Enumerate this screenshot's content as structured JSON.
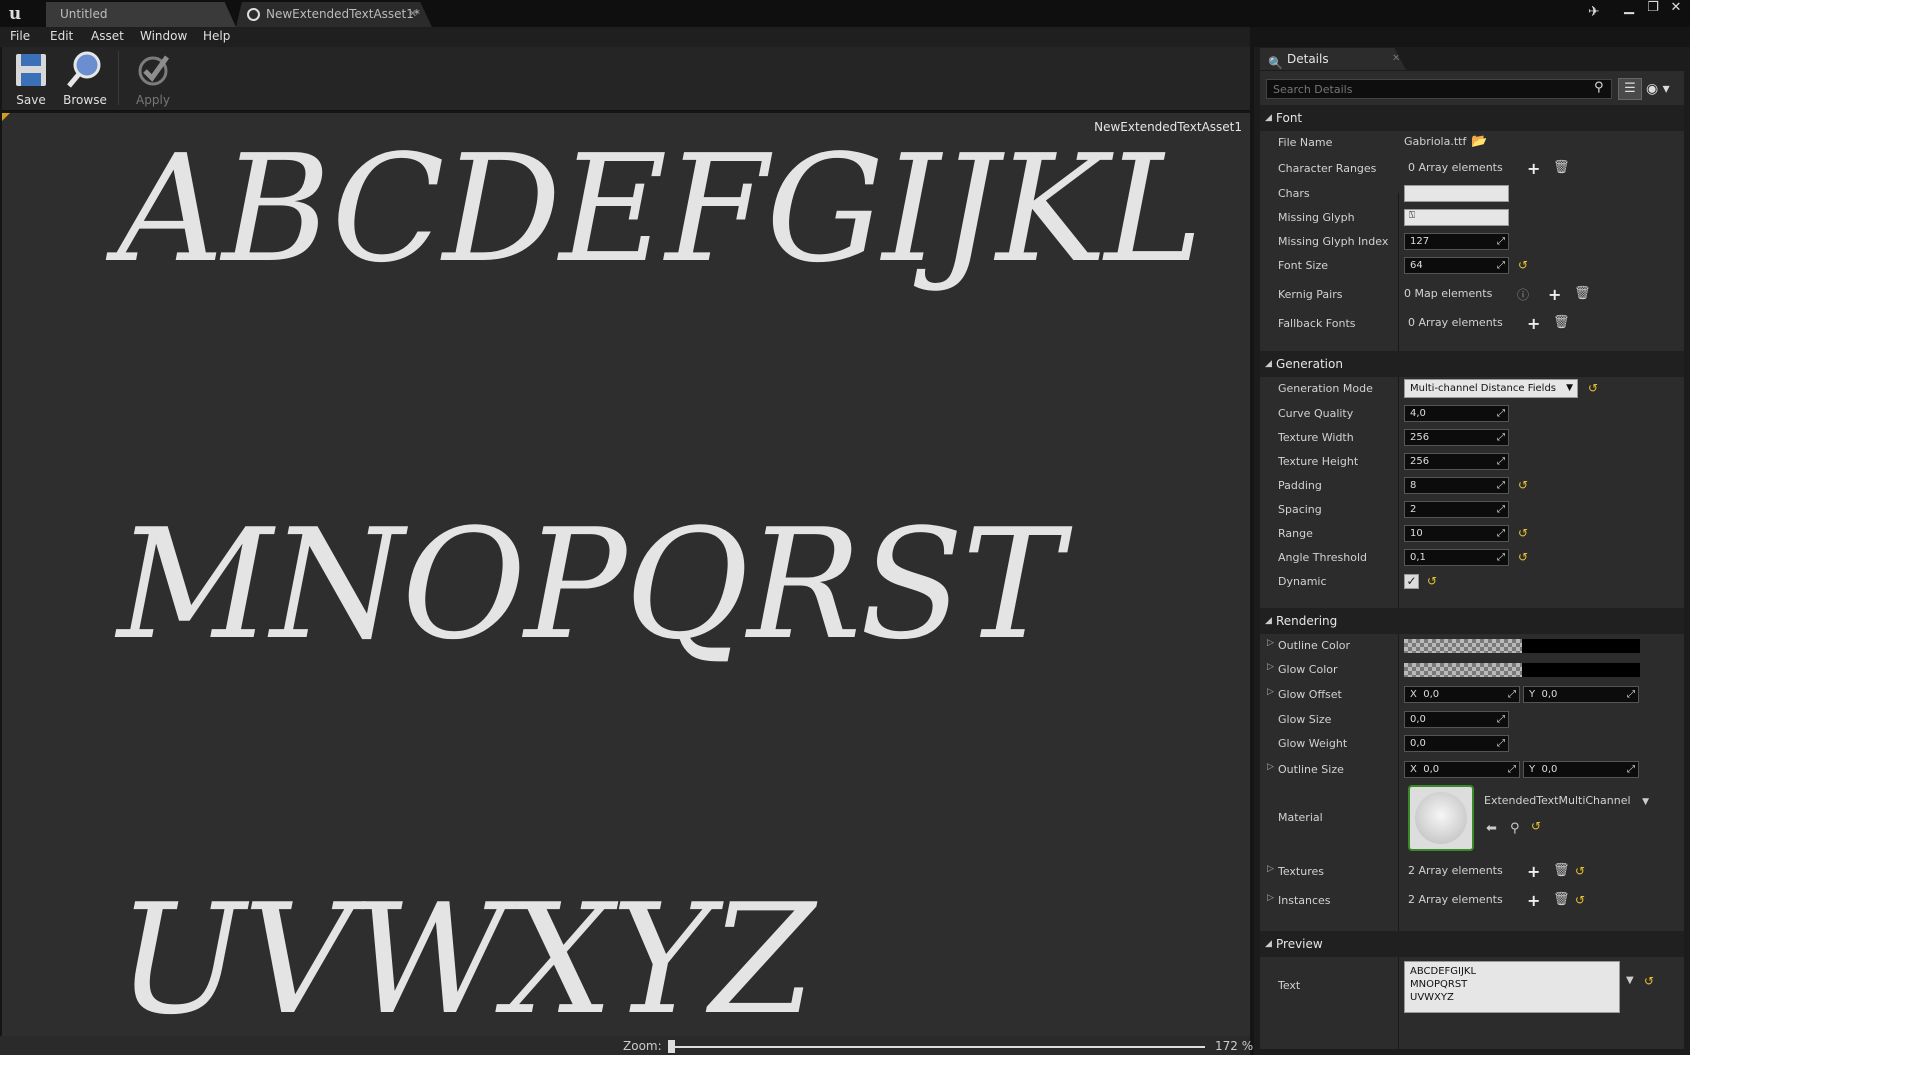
{
  "window": {
    "tabs": [
      {
        "label": "Untitled"
      },
      {
        "label": "NewExtendedTextAsset1*"
      }
    ]
  },
  "menu": [
    "File",
    "Edit",
    "Asset",
    "Window",
    "Help"
  ],
  "toolbar": {
    "save_label": "Save",
    "browse_label": "Browse",
    "apply_label": "Apply"
  },
  "viewport": {
    "asset_name": "NewExtendedTextAsset1",
    "preview_lines": [
      "ABCDEFGIJKL",
      "MNOPQRST",
      "UVWXYZ"
    ]
  },
  "zoom": {
    "label": "Zoom:",
    "value": "172 %",
    "level_fraction": 0.0
  },
  "details": {
    "tab_label": "Details",
    "search_placeholder": "Search Details",
    "sections": {
      "font": {
        "title": "Font",
        "file_name": {
          "label": "File Name",
          "value": "Gabriola.ttf"
        },
        "character_ranges": {
          "label": "Character Ranges",
          "value": "0 Array elements"
        },
        "chars": {
          "label": "Chars"
        },
        "missing_glyph": {
          "label": "Missing Glyph"
        },
        "missing_glyph_index": {
          "label": "Missing Glyph Index",
          "value": "127"
        },
        "font_size": {
          "label": "Font Size",
          "value": "64"
        },
        "kernig_pairs": {
          "label": "Kernig Pairs",
          "value": "0 Map elements"
        },
        "fallback_fonts": {
          "label": "Fallback Fonts",
          "value": "0 Array elements"
        }
      },
      "generation": {
        "title": "Generation",
        "generation_mode": {
          "label": "Generation Mode",
          "value": "Multi-channel Distance Fields"
        },
        "curve_quality": {
          "label": "Curve Quality",
          "value": "4,0"
        },
        "texture_width": {
          "label": "Texture Width",
          "value": "256"
        },
        "texture_height": {
          "label": "Texture Height",
          "value": "256"
        },
        "padding": {
          "label": "Padding",
          "value": "8"
        },
        "spacing": {
          "label": "Spacing",
          "value": "2"
        },
        "range": {
          "label": "Range",
          "value": "10"
        },
        "angle_threshold": {
          "label": "Angle Threshold",
          "value": "0,1"
        },
        "dynamic": {
          "label": "Dynamic",
          "checked": true
        }
      },
      "rendering": {
        "title": "Rendering",
        "outline_color": {
          "label": "Outline Color"
        },
        "glow_color": {
          "label": "Glow Color"
        },
        "glow_offset": {
          "label": "Glow Offset",
          "x_label": "X",
          "x": "0,0",
          "y_label": "Y",
          "y": "0,0"
        },
        "glow_size": {
          "label": "Glow Size",
          "value": "0,0"
        },
        "glow_weight": {
          "label": "Glow Weight",
          "value": "0,0"
        },
        "outline_size": {
          "label": "Outline Size",
          "x_label": "X",
          "x": "0,0",
          "y_label": "Y",
          "y": "0,0"
        },
        "material": {
          "label": "Material",
          "value": "ExtendedTextMultiChannel"
        },
        "textures": {
          "label": "Textures",
          "value": "2 Array elements"
        },
        "instances": {
          "label": "Instances",
          "value": "2 Array elements"
        }
      },
      "preview": {
        "title": "Preview",
        "text": {
          "label": "Text",
          "value": "ABCDEFGIJKL\nMNOPQRST\nUVWXYZ"
        }
      }
    }
  },
  "colors": {
    "accent_orange": "#d49a27",
    "reset_yellow": "#e6c02e",
    "panel_bg": "#2c2c2c",
    "viewport_bg": "#2e2e2e"
  },
  "icons": [
    "ue-logo-icon",
    "asset-tab-icon",
    "save-icon",
    "browse-icon",
    "apply-icon",
    "folder-icon",
    "plus-icon",
    "trash-icon",
    "reset-icon",
    "help-icon",
    "search-icon",
    "eye-icon"
  ]
}
